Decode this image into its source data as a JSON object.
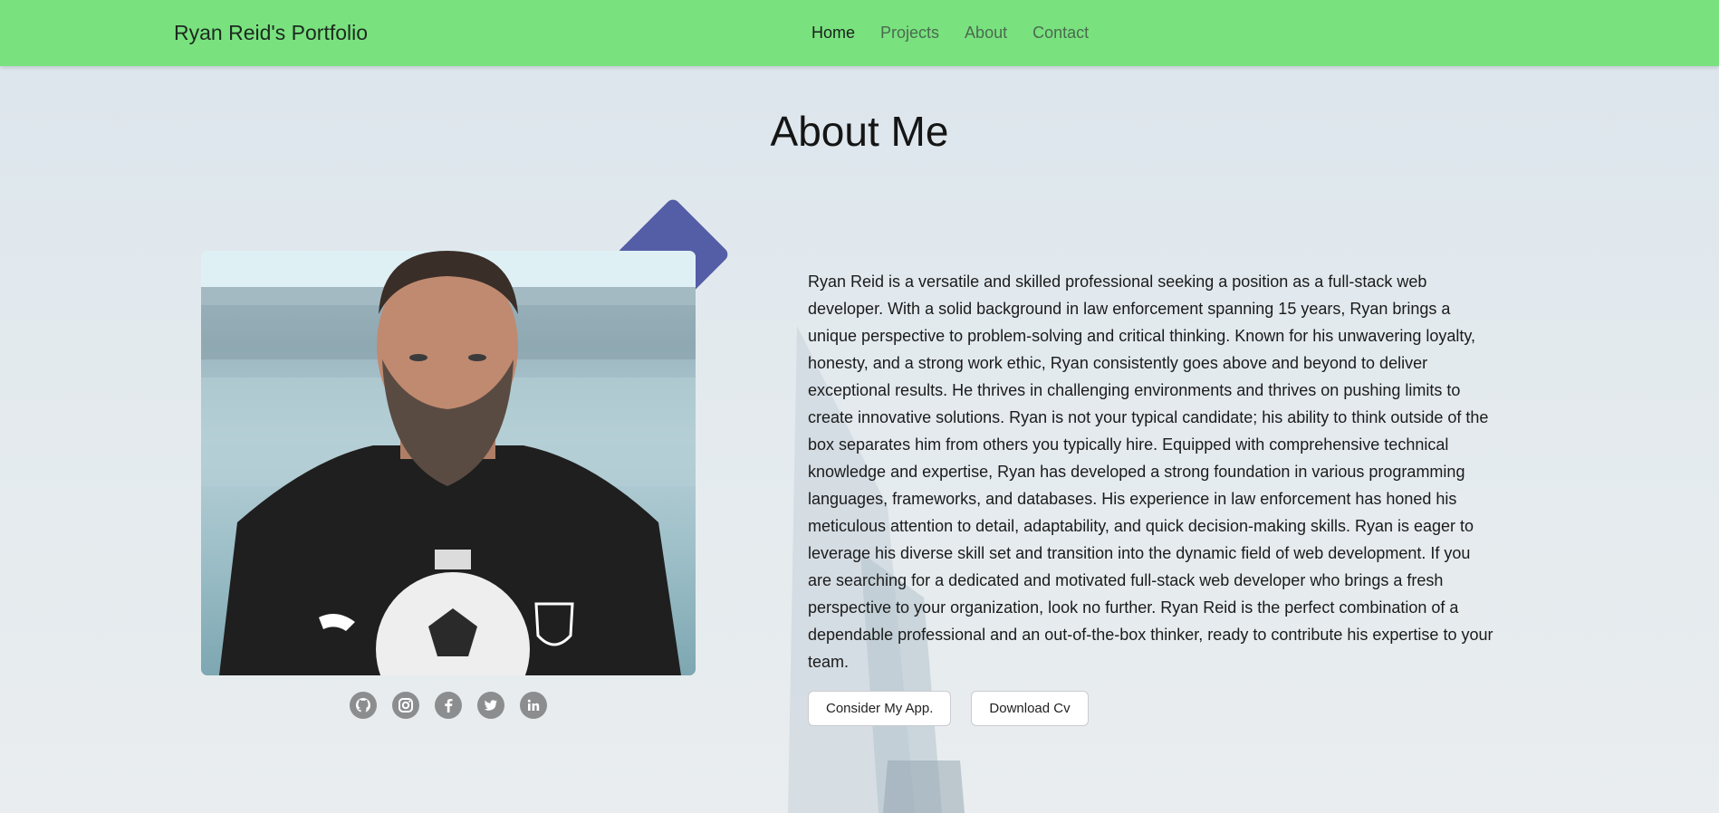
{
  "navbar": {
    "brand": "Ryan Reid's Portfolio",
    "links": [
      {
        "label": "Home",
        "active": true
      },
      {
        "label": "Projects",
        "active": false
      },
      {
        "label": "About",
        "active": false
      },
      {
        "label": "Contact",
        "active": false
      }
    ]
  },
  "about": {
    "title": "About Me",
    "bio": "Ryan Reid is a versatile and skilled professional seeking a position as a full-stack web developer. With a solid background in law enforcement spanning 15 years, Ryan brings a unique perspective to problem-solving and critical thinking. Known for his unwavering loyalty, honesty, and a strong work ethic, Ryan consistently goes above and beyond to deliver exceptional results. He thrives in challenging environments and thrives on pushing limits to create innovative solutions. Ryan is not your typical candidate; his ability to think outside of the box separates him from others you typically hire. Equipped with comprehensive technical knowledge and expertise, Ryan has developed a strong foundation in various programming languages, frameworks, and databases. His experience in law enforcement has honed his meticulous attention to detail, adaptability, and quick decision-making skills. Ryan is eager to leverage his diverse skill set and transition into the dynamic field of web development. If you are searching for a dedicated and motivated full-stack web developer who brings a fresh perspective to your organization, look no further. Ryan Reid is the perfect combination of a dependable professional and an out-of-the-box thinker, ready to contribute his expertise to your team.",
    "buttons": {
      "consider": "Consider My App.",
      "download": "Download Cv"
    }
  },
  "socials": [
    "github-icon",
    "instagram-icon",
    "facebook-icon",
    "twitter-icon",
    "linkedin-icon"
  ],
  "colors": {
    "navbar": "#79e27f",
    "accent_diamond": "#545ea6",
    "social_icon": "#8b8d8f"
  }
}
